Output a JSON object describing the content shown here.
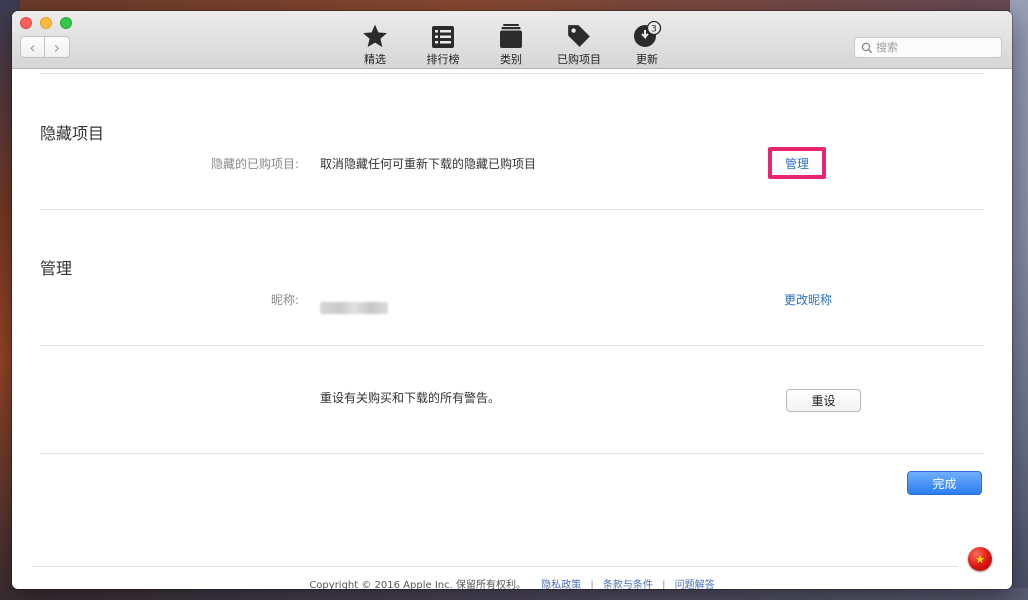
{
  "toolbar": {
    "tabs": [
      {
        "label": "精选",
        "icon": "star-icon"
      },
      {
        "label": "排行榜",
        "icon": "list-icon"
      },
      {
        "label": "类别",
        "icon": "stack-icon"
      },
      {
        "label": "已购项目",
        "icon": "tag-icon"
      },
      {
        "label": "更新",
        "icon": "update-icon",
        "badge": "3"
      }
    ],
    "search_placeholder": "搜索"
  },
  "hidden_section": {
    "title": "隐藏项目",
    "row_label": "隐藏的已购项目:",
    "row_text": "取消隐藏任何可重新下载的隐藏已购项目",
    "action": "管理"
  },
  "manage_section": {
    "title": "管理",
    "nickname_label": "昵称:",
    "nickname_action": "更改昵称"
  },
  "reset_section": {
    "text": "重设有关购买和下载的所有警告。",
    "button": "重设"
  },
  "done_button": "完成",
  "footer": {
    "copyright": "Copyright © 2016 Apple Inc. 保留所有权利。",
    "links": [
      "隐私政策",
      "条款与条件",
      "问题解答"
    ]
  },
  "colors": {
    "link": "#2a6fc6",
    "primary_button": "#2c7cf3",
    "highlight": "#e8256e"
  }
}
